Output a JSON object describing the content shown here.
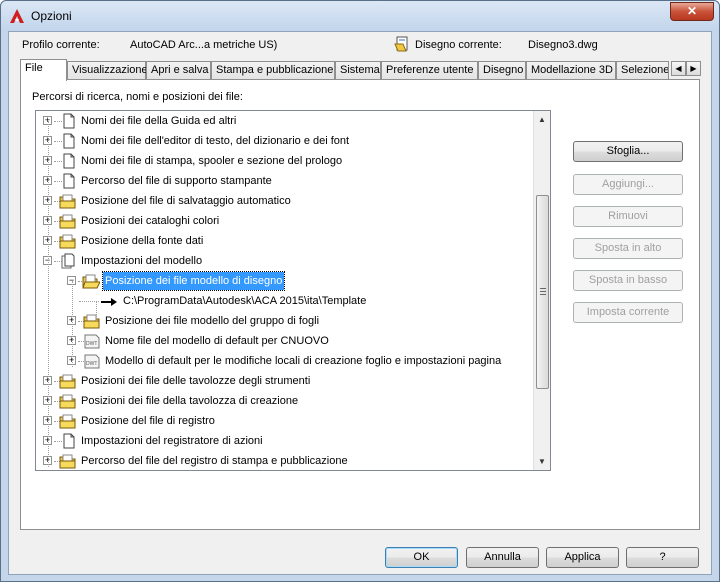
{
  "window": {
    "title": "Opzioni",
    "close_glyph": "✕"
  },
  "profile": {
    "label": "Profilo corrente:",
    "value": "AutoCAD Arc...a metriche US)",
    "drawing_label": "Disegno corrente:",
    "drawing_value": "Disegno3.dwg"
  },
  "tabs": [
    "File",
    "Visualizzazione",
    "Apri e salva",
    "Stampa e pubblicazione",
    "Sistema",
    "Preferenze utente",
    "Disegno",
    "Modellazione 3D",
    "Selezione"
  ],
  "tab_scroll": {
    "left": "◀",
    "right": "▶"
  },
  "panel": {
    "label": "Percorsi di ricerca, nomi e posizioni dei file:"
  },
  "tree": [
    {
      "label": "Nomi dei file della Guida ed altri",
      "icon": "document-icon",
      "expander": "+"
    },
    {
      "label": "Nomi dei file dell'editor di testo, del dizionario e dei font",
      "icon": "document-icon",
      "expander": "+"
    },
    {
      "label": "Nomi dei file di stampa, spooler e sezione del prologo",
      "icon": "document-icon",
      "expander": "+"
    },
    {
      "label": "Percorso del file di supporto stampante",
      "icon": "document-icon",
      "expander": "+"
    },
    {
      "label": "Posizione del file di salvataggio automatico",
      "icon": "folder-icon",
      "expander": "+"
    },
    {
      "label": "Posizioni dei cataloghi colori",
      "icon": "folder-icon",
      "expander": "+"
    },
    {
      "label": "Posizione della fonte dati",
      "icon": "folder-icon",
      "expander": "+"
    },
    {
      "label": "Impostazioni del modello",
      "icon": "documents-icon",
      "expander": "−"
    },
    {
      "label": "Posizione dei file modello di disegno",
      "icon": "folder-open-icon",
      "expander": "−",
      "selected": true
    },
    {
      "label": "C:\\ProgramData\\Autodesk\\ACA 2015\\ita\\Template",
      "icon": "path-arrow-icon",
      "expander": ""
    },
    {
      "label": "Posizione dei file modello del gruppo di fogli",
      "icon": "folder-icon",
      "expander": "+"
    },
    {
      "label": "Nome file del modello di default per CNUOVO",
      "icon": "dwt-file-icon",
      "expander": "+"
    },
    {
      "label": "Modello di default per le modifiche locali di creazione foglio e impostazioni pagina",
      "icon": "dwt-file-icon",
      "expander": "+"
    },
    {
      "label": "Posizioni dei file delle tavolozze degli strumenti",
      "icon": "folder-icon",
      "expander": "+"
    },
    {
      "label": "Posizioni dei file della tavolozza di creazione",
      "icon": "folder-icon",
      "expander": "+"
    },
    {
      "label": "Posizione del file di registro",
      "icon": "folder-icon",
      "expander": "+"
    },
    {
      "label": "Impostazioni del registratore di azioni",
      "icon": "document-icon",
      "expander": "+"
    },
    {
      "label": "Percorso del file del registro di stampa e pubblicazione",
      "icon": "folder-icon",
      "expander": "+"
    }
  ],
  "scrollbar": {
    "up": "▲",
    "down": "▼"
  },
  "side_buttons": {
    "browse": "Sfoglia...",
    "add": "Aggiungi...",
    "remove": "Rimuovi",
    "move_up": "Sposta in alto",
    "move_down": "Sposta in basso",
    "set_current": "Imposta corrente"
  },
  "footer_buttons": {
    "ok": "OK",
    "cancel": "Annulla",
    "apply": "Applica",
    "help": "?"
  }
}
